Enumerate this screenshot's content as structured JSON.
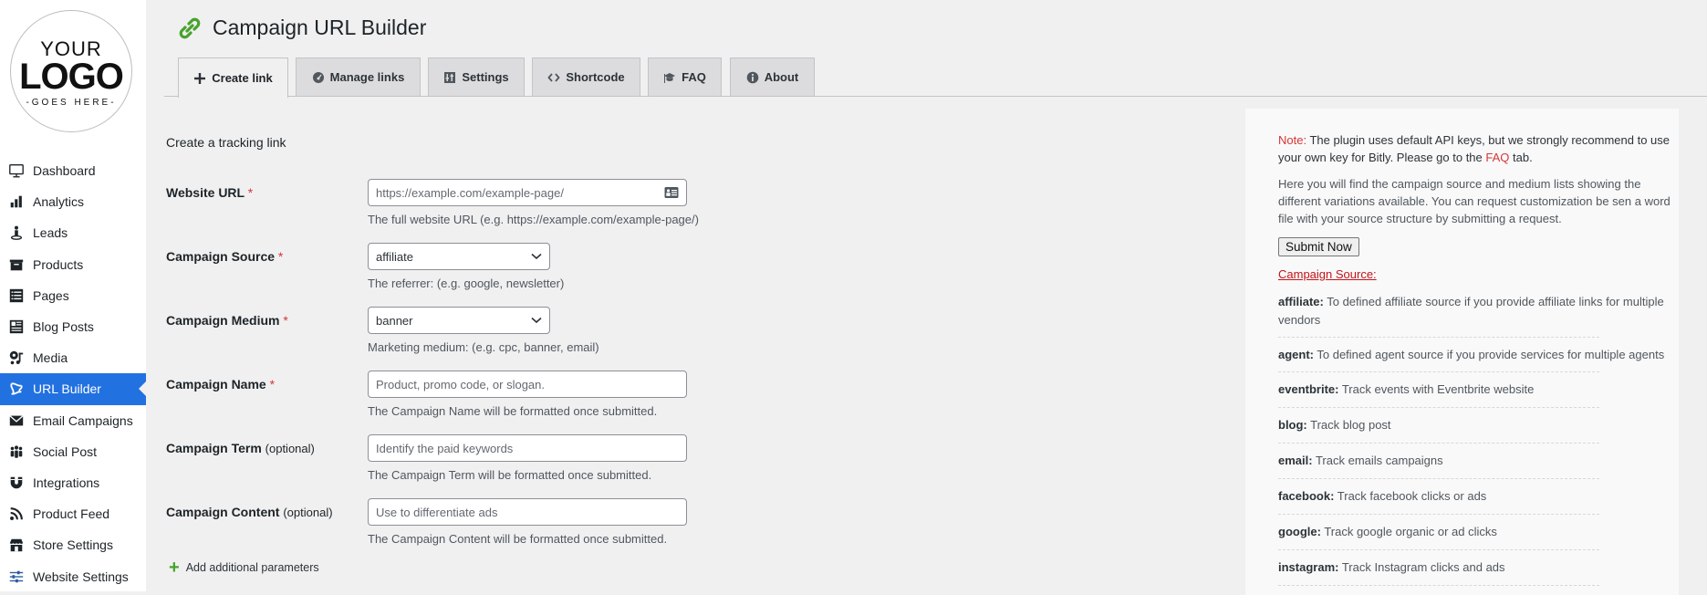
{
  "logo": {
    "line1": "YOUR",
    "line2": "LOGO",
    "line3": "-GOES HERE-"
  },
  "sidebar": {
    "items": [
      {
        "label": "Dashboard",
        "icon": "monitor-icon",
        "active": false
      },
      {
        "label": "Analytics",
        "icon": "bar-chart-icon",
        "active": false
      },
      {
        "label": "Leads",
        "icon": "person-pin-icon",
        "active": false
      },
      {
        "label": "Products",
        "icon": "archive-box-icon",
        "active": false
      },
      {
        "label": "Pages",
        "icon": "list-icon",
        "active": false
      },
      {
        "label": "Blog Posts",
        "icon": "newspaper-icon",
        "active": false
      },
      {
        "label": "Media",
        "icon": "media-icon",
        "active": false
      },
      {
        "label": "URL Builder",
        "icon": "url-builder-icon",
        "active": true
      },
      {
        "label": "Email Campaigns",
        "icon": "envelope-icon",
        "active": false
      },
      {
        "label": "Social Post",
        "icon": "people-icon",
        "active": false
      },
      {
        "label": "Integrations",
        "icon": "magnet-icon",
        "active": false
      },
      {
        "label": "Product Feed",
        "icon": "rss-icon",
        "active": false
      },
      {
        "label": "Store Settings",
        "icon": "store-icon",
        "active": false
      },
      {
        "label": "Website Settings",
        "icon": "sliders-icon",
        "active": false
      }
    ],
    "active_color": "#2271e0"
  },
  "header": {
    "title": "Campaign URL Builder",
    "icon": "link-icon",
    "icon_color": "#46a32b"
  },
  "tabs": [
    {
      "label": "Create link",
      "icon": "plus-icon",
      "active": true
    },
    {
      "label": "Manage links",
      "icon": "dashboard-gauge-icon",
      "active": false
    },
    {
      "label": "Settings",
      "icon": "settings-icon",
      "active": false
    },
    {
      "label": "Shortcode",
      "icon": "code-icon",
      "active": false
    },
    {
      "label": "FAQ",
      "icon": "graduation-cap-icon",
      "active": false
    },
    {
      "label": "About",
      "icon": "info-icon",
      "active": false
    }
  ],
  "form": {
    "section_title": "Create a tracking link",
    "required_mark": "*",
    "fields": {
      "website_url": {
        "label": "Website URL",
        "placeholder": "https://example.com/example-page/",
        "value": "",
        "help": "The full website URL (e.g. https://example.com/example-page/)"
      },
      "campaign_source": {
        "label": "Campaign Source",
        "selected": "affiliate",
        "help": "The referrer: (e.g. google, newsletter)"
      },
      "campaign_medium": {
        "label": "Campaign Medium",
        "selected": "banner",
        "help": "Marketing medium: (e.g. cpc, banner, email)"
      },
      "campaign_name": {
        "label": "Campaign Name",
        "placeholder": "Product, promo code, or slogan.",
        "value": "",
        "help": "The Campaign Name will be formatted once submitted."
      },
      "campaign_term": {
        "label": "Campaign Term",
        "optional": "(optional)",
        "placeholder": "Identify the paid keywords",
        "value": "",
        "help": "The Campaign Term will be formatted once submitted."
      },
      "campaign_content": {
        "label": "Campaign Content",
        "optional": "(optional)",
        "placeholder": "Use to differentiate ads",
        "value": "",
        "help": "The Campaign Content will be formatted once submitted."
      }
    },
    "add_params_label": "Add additional parameters"
  },
  "panel": {
    "note_prefix": "Note:",
    "note_text_1": " The plugin uses default API keys, but we strongly recommend to use your own key for Bitly. Please go to the ",
    "note_link": "FAQ",
    "note_text_2": " tab.",
    "description": "Here you will find the campaign source and medium lists showing the different variations available. You can request customization be sen a word file with your source structure by submitting a request.",
    "submit_label": "Submit Now",
    "source_heading": "Campaign Source:",
    "sources": [
      {
        "key": "affiliate:",
        "desc": " To defined affiliate source if you provide affiliate links for multiple vendors"
      },
      {
        "key": "agent:",
        "desc": " To defined agent source if you provide services for multiple agents"
      },
      {
        "key": "eventbrite:",
        "desc": " Track events with Eventbrite website"
      },
      {
        "key": "blog:",
        "desc": " Track blog post"
      },
      {
        "key": "email:",
        "desc": " Track emails campaigns"
      },
      {
        "key": "facebook:",
        "desc": " Track facebook clicks or ads"
      },
      {
        "key": "google:",
        "desc": " Track google organic or ad clicks"
      },
      {
        "key": "instagram:",
        "desc": " Track Instagram clicks and ads"
      }
    ]
  }
}
